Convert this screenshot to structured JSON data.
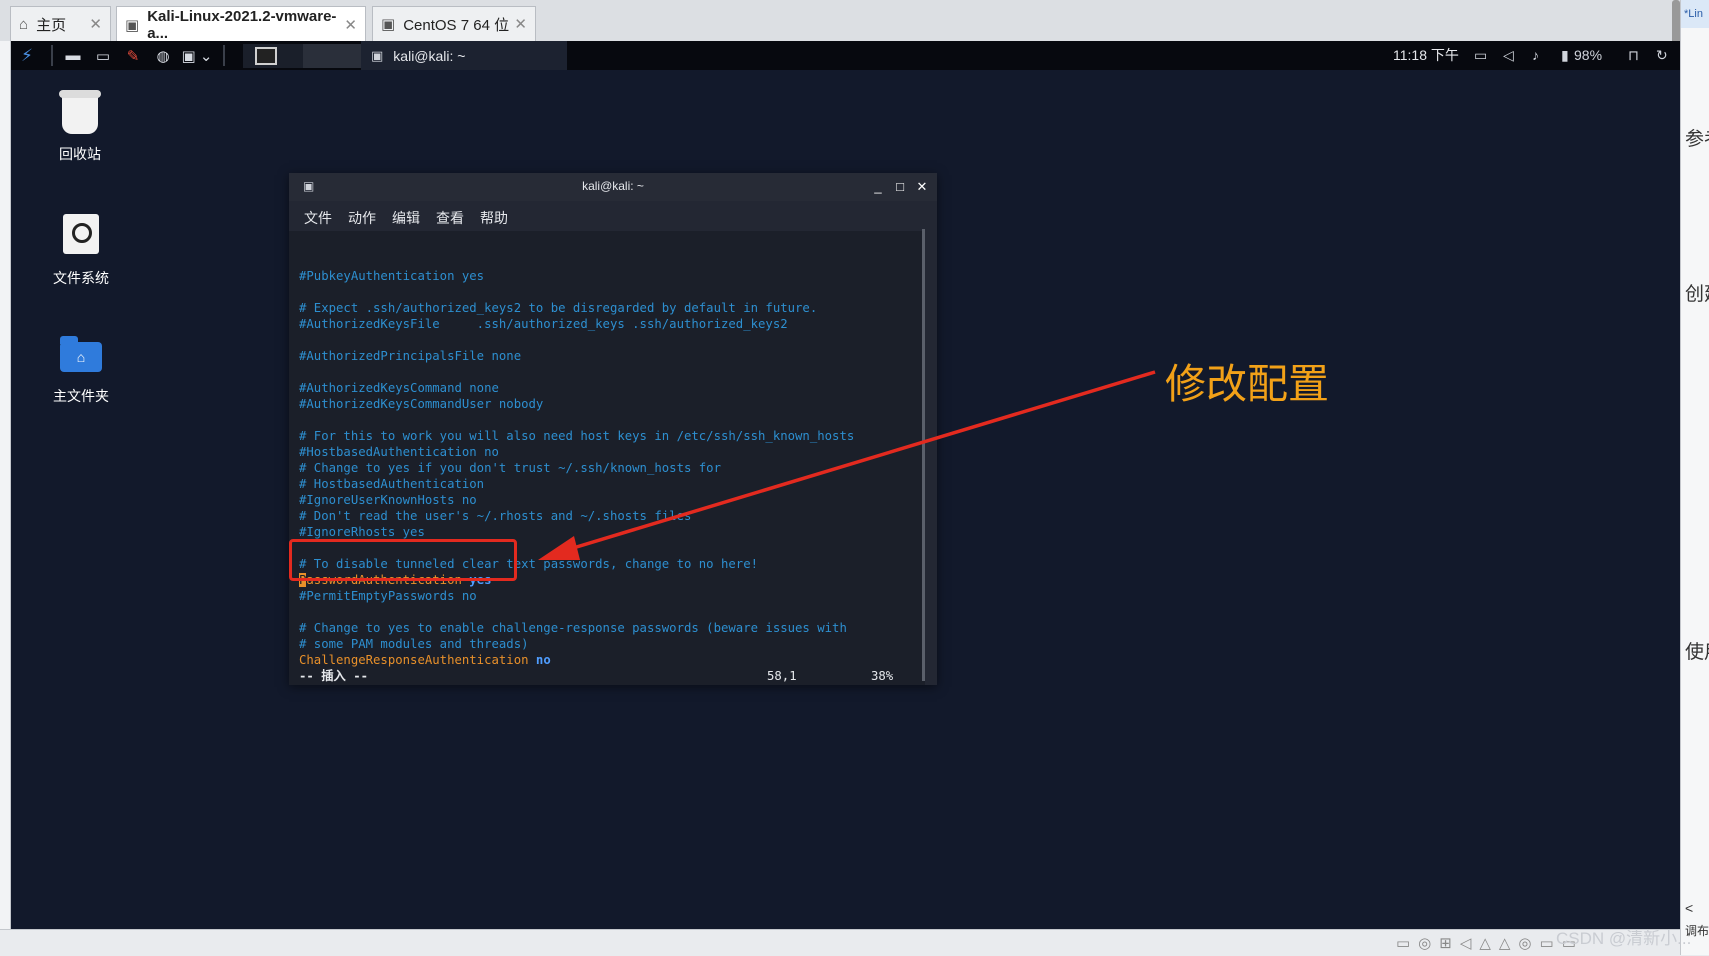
{
  "host": {
    "tabs": [
      {
        "label": "主页",
        "icon": "home-icon"
      },
      {
        "label": "Kali-Linux-2021.2-vmware-a...",
        "icon": "vm-icon"
      },
      {
        "label": "CentOS 7 64 位",
        "icon": "vm-icon"
      }
    ],
    "right_panel": {
      "top": "*Lin",
      "texts": [
        "参考",
        "创建",
        "使用",
        "<",
        "调布"
      ]
    },
    "watermark": "CSDN @清新小..."
  },
  "kali_panel": {
    "task_title": "kali@kali: ~",
    "clock": "11:18 下午",
    "battery": "98%"
  },
  "desktop_icons": [
    {
      "label": "回收站",
      "icon": "trash-icon"
    },
    {
      "label": "文件系统",
      "icon": "filesystem-icon"
    },
    {
      "label": "主文件夹",
      "icon": "home-folder-icon"
    }
  ],
  "terminal": {
    "title": "kali@kali: ~",
    "menu": [
      "文件",
      "动作",
      "编辑",
      "查看",
      "帮助"
    ],
    "lines": [
      "#PubkeyAuthentication yes",
      "",
      "# Expect .ssh/authorized_keys2 to be disregarded by default in future.",
      "#AuthorizedKeysFile     .ssh/authorized_keys .ssh/authorized_keys2",
      "",
      "#AuthorizedPrincipalsFile none",
      "",
      "#AuthorizedKeysCommand none",
      "#AuthorizedKeysCommandUser nobody",
      "",
      "# For this to work you will also need host keys in /etc/ssh/ssh_known_hosts",
      "#HostbasedAuthentication no",
      "# Change to yes if you don't trust ~/.ssh/known_hosts for",
      "# HostbasedAuthentication",
      "#IgnoreUserKnownHosts no",
      "# Don't read the user's ~/.rhosts and ~/.shosts files",
      "#IgnoreRhosts yes",
      "",
      "# To disable tunneled clear text passwords, change to no here!"
    ],
    "pw_cursor": "P",
    "pw_key": "asswordAuthentication",
    "pw_value": "yes",
    "permit_empty": "#PermitEmptyPasswords no",
    "lines2": [
      "# Change to yes to enable challenge-response passwords (beware issues with",
      "# some PAM modules and threads)"
    ],
    "challenge_key": "ChallengeResponseAuthentication",
    "challenge_value": "no",
    "mode": "-- 插入 --",
    "position": "58,1",
    "percent": "38%"
  },
  "annotation": {
    "text": "修改配置",
    "color": "#f2a118",
    "box_color": "#e32a1f"
  }
}
